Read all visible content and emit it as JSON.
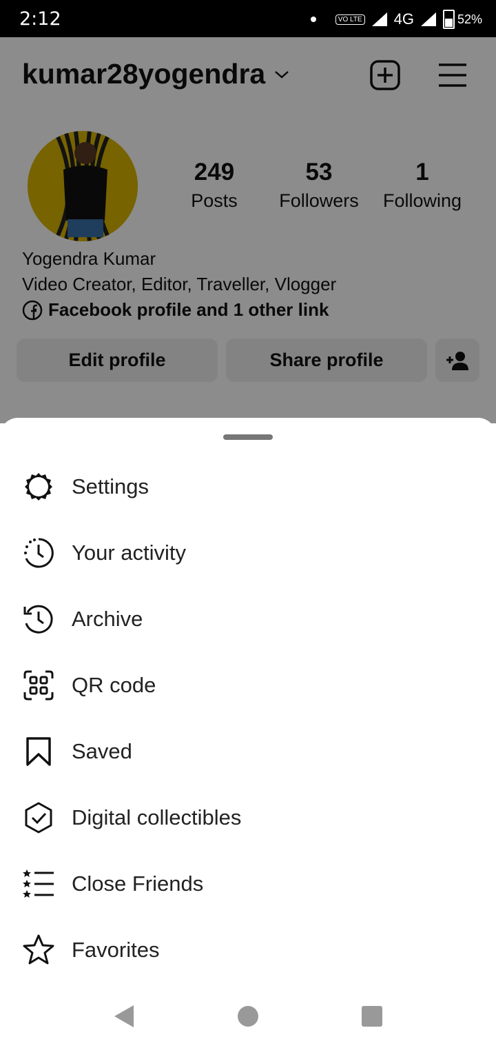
{
  "status_bar": {
    "time": "2:12",
    "volte": "VO LTE",
    "network": "4G",
    "battery": "52%"
  },
  "profile": {
    "username": "kumar28yogendra",
    "stats": [
      {
        "value": "249",
        "label": "Posts"
      },
      {
        "value": "53",
        "label": "Followers"
      },
      {
        "value": "1",
        "label": "Following"
      }
    ],
    "full_name": "Yogendra Kumar",
    "bio": "Video Creator, Editor, Traveller, Vlogger",
    "link_text": "Facebook profile and 1 other link",
    "edit_button": "Edit profile",
    "share_button": "Share profile"
  },
  "menu": [
    {
      "label": "Settings",
      "icon": "settings-gear-icon"
    },
    {
      "label": "Your activity",
      "icon": "activity-clock-icon"
    },
    {
      "label": "Archive",
      "icon": "archive-history-icon"
    },
    {
      "label": "QR code",
      "icon": "qr-code-icon"
    },
    {
      "label": "Saved",
      "icon": "bookmark-icon"
    },
    {
      "label": "Digital collectibles",
      "icon": "check-hexagon-icon"
    },
    {
      "label": "Close Friends",
      "icon": "star-list-icon"
    },
    {
      "label": "Favorites",
      "icon": "star-icon"
    }
  ],
  "colors": {
    "overlay": "rgba(0,0,0,0.45)",
    "button_bg": "#efefef",
    "avatar_bg": "#d9b400"
  }
}
